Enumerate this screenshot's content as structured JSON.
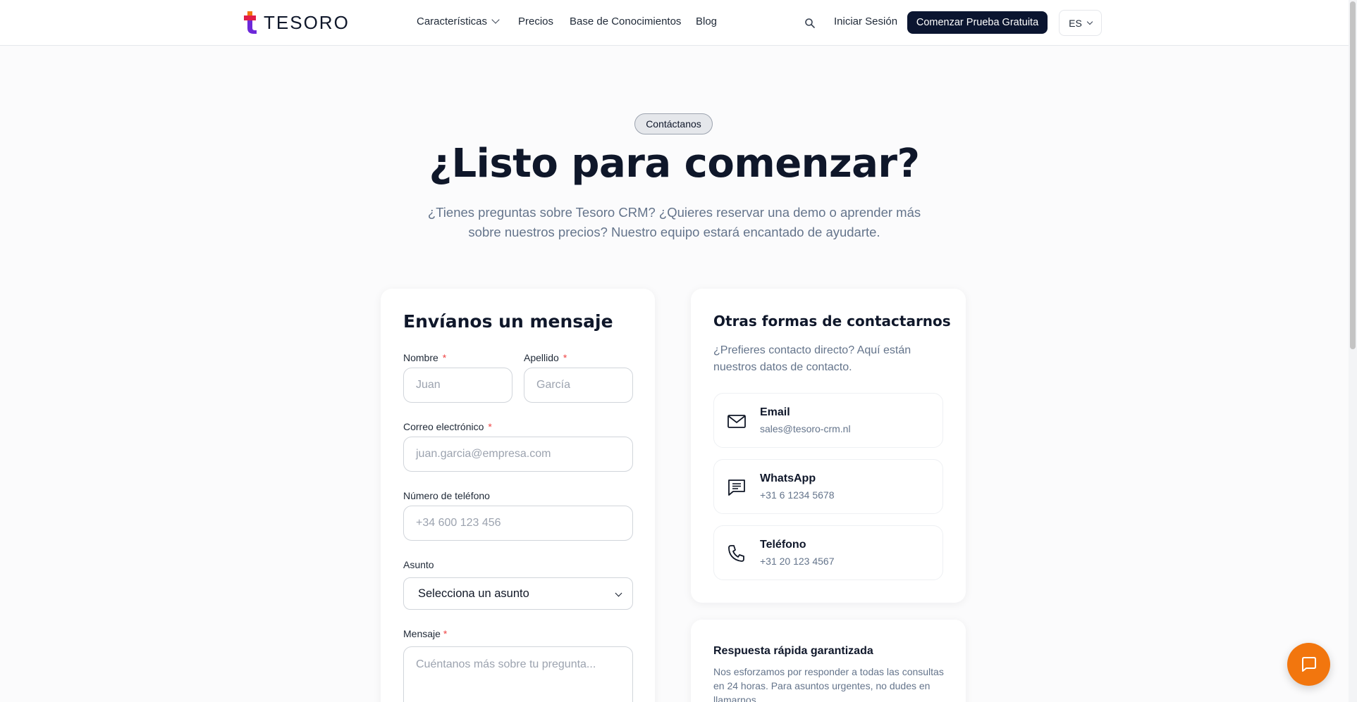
{
  "header": {
    "logo_text": "TESORO",
    "nav": {
      "features": "Características",
      "pricing": "Precios",
      "knowledge_base": "Base de Conocimientos",
      "blog": "Blog"
    },
    "login": "Iniciar Sesión",
    "cta": "Comenzar Prueba Gratuita",
    "language": "ES"
  },
  "hero": {
    "badge": "Contáctanos",
    "title": "¿Listo para comenzar?",
    "subtitle": "¿Tienes preguntas sobre Tesoro CRM? ¿Quieres reservar una demo o aprender más sobre nuestros precios? Nuestro equipo estará encantado de ayudarte."
  },
  "form": {
    "title": "Envíanos un mensaje",
    "first_name": {
      "label": "Nombre",
      "required": "*",
      "placeholder": "Juan"
    },
    "last_name": {
      "label": "Apellido",
      "required": "*",
      "placeholder": "García"
    },
    "email": {
      "label": "Correo electrónico",
      "required": "*",
      "placeholder": "juan.garcia@empresa.com"
    },
    "phone": {
      "label": "Número de teléfono",
      "placeholder": "+34 600 123 456"
    },
    "subject": {
      "label": "Asunto",
      "selected": "Selecciona un asunto"
    },
    "message": {
      "label": "Mensaje",
      "required": "*",
      "placeholder": "Cuéntanos más sobre tu pregunta..."
    }
  },
  "contact": {
    "title": "Otras formas de contactarnos",
    "subtitle": "¿Prefieres contacto directo? Aquí están nuestros datos de contacto.",
    "items": [
      {
        "title": "Email",
        "value": "sales@tesoro-crm.nl",
        "icon": "mail-icon"
      },
      {
        "title": "WhatsApp",
        "value": "+31 6 1234 5678",
        "icon": "message-icon"
      },
      {
        "title": "Teléfono",
        "value": "+31 20 123 4567",
        "icon": "phone-icon"
      }
    ]
  },
  "fast_response": {
    "title": "Respuesta rápida garantizada",
    "text": "Nos esforzamos por responder a todas las consultas en 24 horas. Para asuntos urgentes, no dudes en llamarnos."
  },
  "colors": {
    "primary_dark": "#0b1530",
    "accent_orange": "#f2760e",
    "required_red": "#ef4444",
    "muted_text": "#64748b"
  }
}
